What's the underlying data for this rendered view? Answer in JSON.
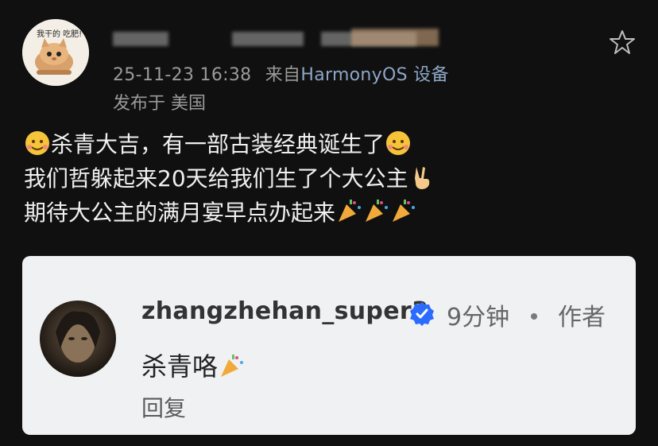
{
  "post": {
    "author": {
      "avatar_text": "我干的 吃肥!"
    },
    "meta": {
      "time": "25-11-23 16:38",
      "source_prefix": "来自",
      "source": "HarmonyOS 设备",
      "location": "发布于 美国"
    },
    "lines": [
      "杀青大吉，有一部古装经典诞生了",
      "我们哲躲起来20天给我们生了个大公主",
      "期待大公主的满月宴早点办起来"
    ],
    "icons": [
      "star-icon",
      "cheer-face-icon",
      "victory-hand-icon",
      "party-popper-icon"
    ]
  },
  "comment": {
    "username": "zhangzhehan_super3",
    "time": "9分钟",
    "role": "作者",
    "text": "杀青咯",
    "reply_label": "回复",
    "accent": "#2b6cff"
  }
}
